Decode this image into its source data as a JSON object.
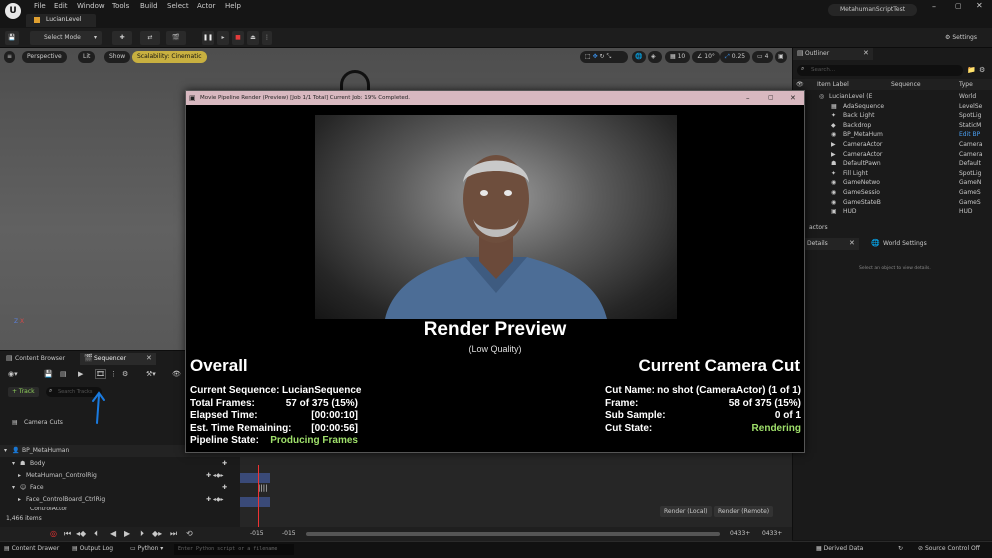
{
  "app": {
    "logo": "unreal-logo",
    "project_tab": "LucianLevel",
    "project_name": "MetahumanScriptTest"
  },
  "menu": [
    "File",
    "Edit",
    "Window",
    "Tools",
    "Build",
    "Select",
    "Actor",
    "Help"
  ],
  "toolbar": {
    "select_mode": "Select Mode",
    "settings": "Settings"
  },
  "viewport": {
    "perspective": "Perspective",
    "lit": "Lit",
    "show": "Show",
    "scalability": "Scalability: Cinematic",
    "grid_size": "10",
    "rot": "10°",
    "scale": "0.25",
    "cam_speed": "4"
  },
  "outliner": {
    "title": "Outliner",
    "search_placeholder": "Search...",
    "col_label": "Item Label",
    "col_sequence": "Sequence",
    "col_type": "Type",
    "rows": [
      {
        "label": "LucianLevel (E",
        "type": "World"
      },
      {
        "label": "AdaSequence",
        "type": "LevelSe"
      },
      {
        "label": "Back Light",
        "type": "SpotLig"
      },
      {
        "label": "Backdrop",
        "type": "StaticM"
      },
      {
        "label": "BP_MetaHum",
        "type": "Edit BP"
      },
      {
        "label": "CameraActor",
        "type": "Camera"
      },
      {
        "label": "CameraActor",
        "type": "Camera"
      },
      {
        "label": "DefaultPawn",
        "type": "Default"
      },
      {
        "label": "Fill Light",
        "type": "SpotLig"
      },
      {
        "label": "GameNetwo",
        "type": "GameN"
      },
      {
        "label": "GameSessio",
        "type": "GameS"
      },
      {
        "label": "GameStateB",
        "type": "GameS"
      },
      {
        "label": "HUD",
        "type": "HUD"
      }
    ],
    "count": "actors"
  },
  "details": {
    "tab": "Details",
    "world_tab": "World Settings",
    "empty": "Select an object to view details."
  },
  "bottom_tabs": {
    "content_browser": "Content Browser",
    "sequencer": "Sequencer"
  },
  "sequencer": {
    "add_track": "+ Track",
    "search_placeholder": "Search Tracks",
    "tracks": [
      "Camera Cuts",
      "BP_MetaHuman",
      "Body",
      "MetaHuman_ControlRig",
      "Face",
      "Face_ControlBoard_CtrlRig",
      "ControlActor"
    ],
    "items_count": "1,466 items",
    "time_a": "-015",
    "time_b": "-015",
    "time_c": "0433+",
    "time_d": "0433+",
    "render_local": "Render (Local)",
    "render_remote": "Render (Remote)"
  },
  "statusbar": {
    "content_drawer": "Content Drawer",
    "output_log": "Output Log",
    "python": "Python",
    "cmd_placeholder": "Enter Python script or a filename",
    "derived_data": "Derived Data",
    "source_control": "Source Control Off"
  },
  "render_window": {
    "title": "Movie Pipeline Render (Preview) [Job 1/1 Total] Current Job: 19% Completed.",
    "heading": "Render Preview",
    "subheading": "(Low Quality)",
    "overall": "Overall",
    "current_cut": "Current Camera Cut",
    "left_labels": [
      "Current Sequence:",
      "Total Frames:",
      "Elapsed Time:",
      "Est. Time Remaining:",
      "Pipeline State:"
    ],
    "left_values": [
      "LucianSequence",
      "57 of 375 (15%)",
      "[00:00:10]",
      "[00:00:56]",
      "Producing Frames"
    ],
    "right_labels": [
      "Cut Name:",
      "Frame:",
      "Sub Sample:",
      "Cut State:"
    ],
    "right_values": [
      "no shot (CameraActor) (1 of 1)",
      "58 of 375 (15%)",
      "0 of 1",
      "Rendering"
    ],
    "progress": 0.15
  },
  "colors": {
    "accent": "#0070e0",
    "status_green": "#9fe06b",
    "titlebar": "#d8b8c0"
  }
}
